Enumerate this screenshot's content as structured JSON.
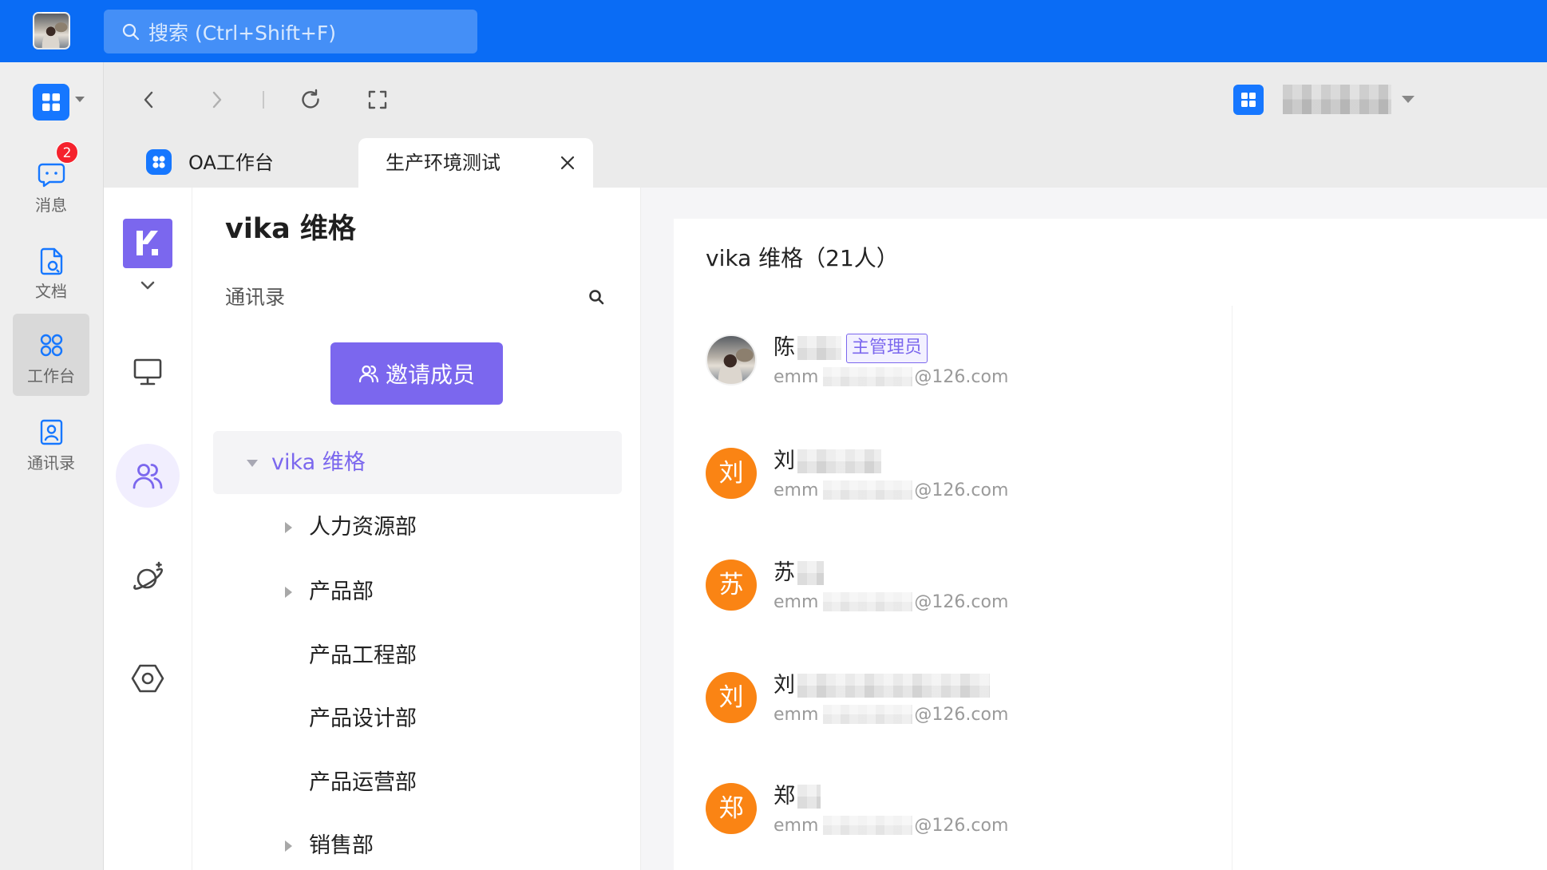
{
  "app": {
    "search_placeholder": "搜索 (Ctrl+Shift+F)"
  },
  "colors": {
    "topbar": "#0a6cf5",
    "accent_blue": "#1677ff",
    "vika_purple": "#7b67ee",
    "avatar_orange": "#fa8414",
    "badge_red": "#f5222d"
  },
  "sidebar": {
    "notification_badge": "2",
    "items": [
      {
        "label": "消息",
        "icon": "message-icon",
        "active": false
      },
      {
        "label": "文档",
        "icon": "document-icon",
        "active": false
      },
      {
        "label": "工作台",
        "icon": "workbench-icon",
        "active": true
      },
      {
        "label": "通讯录",
        "icon": "contacts-icon",
        "active": false
      }
    ]
  },
  "tabs": [
    {
      "label": "OA工作台",
      "icon": "oa-app-icon",
      "active": false
    },
    {
      "label": "生产环境测试",
      "active": true
    }
  ],
  "vika_nav": {
    "icons": [
      "vika-logo",
      "chevron-down-icon",
      "monitor-icon",
      "people-icon",
      "planet-icon",
      "settings-hexagon-icon"
    ],
    "active": "people-icon"
  },
  "contacts_panel": {
    "space_name": "vika 维格",
    "section_title": "通讯录",
    "invite_button": "邀请成员"
  },
  "org_tree": {
    "root": {
      "label": "vika 维格",
      "expanded": true,
      "selected": true
    },
    "children": [
      {
        "label": "人力资源部",
        "expandable": true
      },
      {
        "label": "产品部",
        "expandable": true
      },
      {
        "label": "产品工程部",
        "expandable": false
      },
      {
        "label": "产品设计部",
        "expandable": false
      },
      {
        "label": "产品运营部",
        "expandable": false
      },
      {
        "label": "销售部",
        "expandable": true
      }
    ]
  },
  "members": {
    "title": "vika 维格（21人）",
    "list": [
      {
        "avatar_type": "photo",
        "name": "陈",
        "role_badge": "主管理员",
        "email_prefix": "emm",
        "email_suffix": "@126.com"
      },
      {
        "avatar_type": "letter",
        "avatar_text": "刘",
        "name": "刘",
        "email_prefix": "emm",
        "email_suffix": "@126.com"
      },
      {
        "avatar_type": "letter",
        "avatar_text": "苏",
        "name": "苏",
        "email_prefix": "emm",
        "email_suffix": "@126.com"
      },
      {
        "avatar_type": "letter",
        "avatar_text": "刘",
        "name": "刘",
        "email_prefix": "emm",
        "email_suffix": "@126.com"
      },
      {
        "avatar_type": "letter",
        "avatar_text": "郑",
        "name": "郑",
        "email_prefix": "emm",
        "email_suffix": "@126.com"
      }
    ]
  }
}
